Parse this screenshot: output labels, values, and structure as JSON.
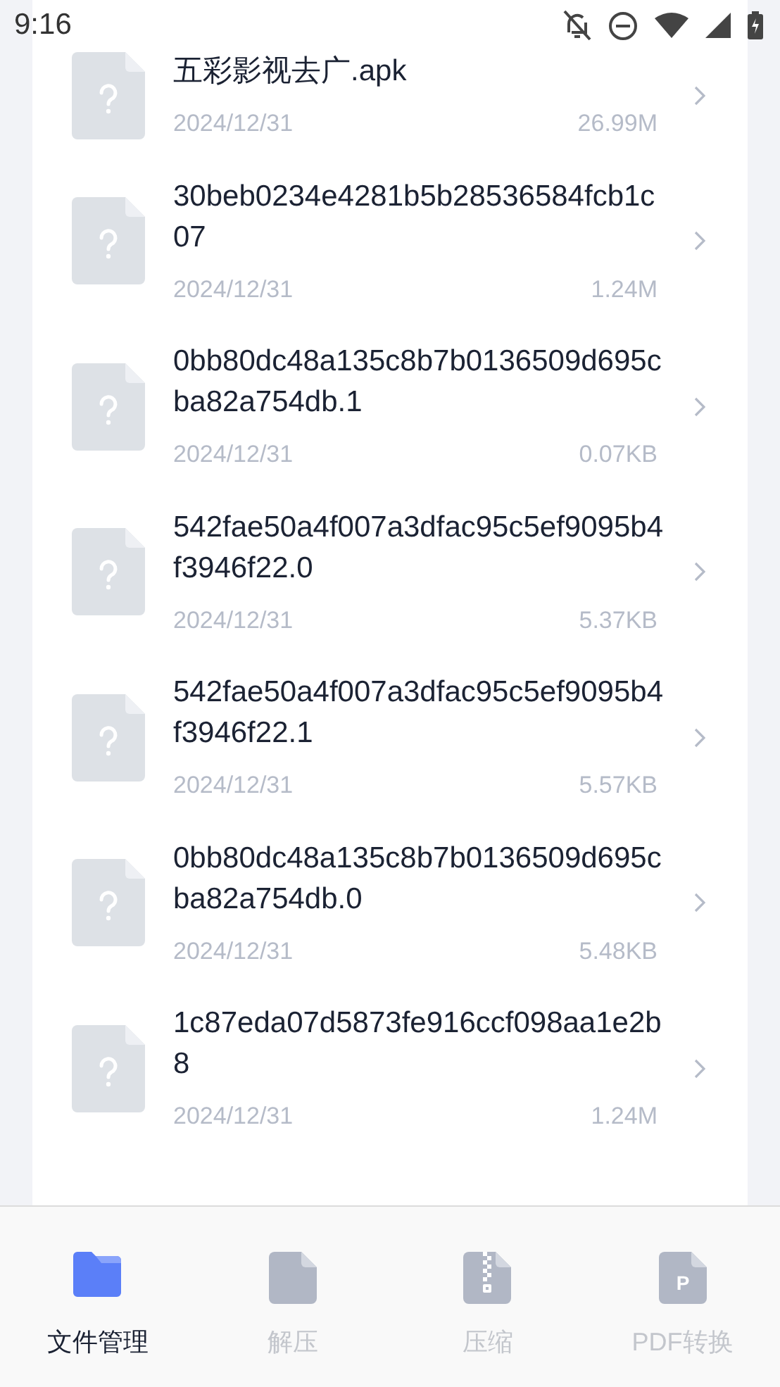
{
  "status_bar": {
    "time": "9:16"
  },
  "files": [
    {
      "name": "五彩影视去广.apk",
      "date": "2024/12/31",
      "size": "26.99M"
    },
    {
      "name": "30beb0234e4281b5b28536584fcb1c07",
      "date": "2024/12/31",
      "size": "1.24M"
    },
    {
      "name": "0bb80dc48a135c8b7b0136509d695cba82a754db.1",
      "date": "2024/12/31",
      "size": "0.07KB"
    },
    {
      "name": "542fae50a4f007a3dfac95c5ef9095b4f3946f22.0",
      "date": "2024/12/31",
      "size": "5.37KB"
    },
    {
      "name": "542fae50a4f007a3dfac95c5ef9095b4f3946f22.1",
      "date": "2024/12/31",
      "size": "5.57KB"
    },
    {
      "name": "0bb80dc48a135c8b7b0136509d695cba82a754db.0",
      "date": "2024/12/31",
      "size": "5.48KB"
    },
    {
      "name": "1c87eda07d5873fe916ccf098aa1e2b8",
      "date": "2024/12/31",
      "size": "1.24M"
    }
  ],
  "nav_tabs": [
    {
      "kind": "folder",
      "label": "文件管理",
      "selected": true
    },
    {
      "kind": "file",
      "label": "解压",
      "selected": false
    },
    {
      "kind": "zip",
      "label": "压缩",
      "selected": false
    },
    {
      "kind": "pdf",
      "label": "PDF转换",
      "icon_text": "P",
      "selected": false
    }
  ]
}
